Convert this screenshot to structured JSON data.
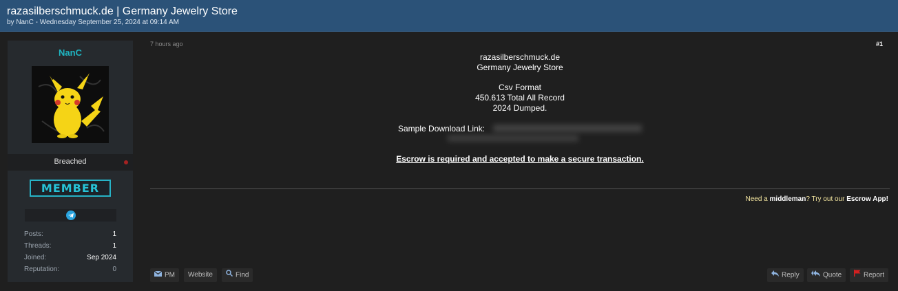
{
  "thread": {
    "title": "razasilberschmuck.de | Germany Jewelry Store",
    "byline": "by NanC - Wednesday September 25, 2024 at 09:14 AM"
  },
  "author": {
    "username": "NanC",
    "status": "Breached",
    "rank": "MEMBER",
    "contact_icon": "telegram-icon",
    "stats": [
      {
        "label": "Posts:",
        "value": "1"
      },
      {
        "label": "Threads:",
        "value": "1"
      },
      {
        "label": "Joined:",
        "value": "Sep 2024"
      },
      {
        "label": "Reputation:",
        "value": "0"
      }
    ]
  },
  "post": {
    "time": "7 hours ago",
    "number": "#1",
    "lines": [
      "razasilberschmuck.de",
      "Germany Jewelry Store",
      "Csv Format",
      "450.613 Total All Record",
      "2024 Dumped."
    ],
    "sample_label": "Sample Download Link:",
    "escrow_text": " Escrow is required and accepted to make a secure transaction.",
    "signature": {
      "pre": "Need a ",
      "middleman": "middleman",
      "mid": "? Try out our ",
      "escrow_app": "Escrow App!"
    }
  },
  "actions": {
    "pm": "PM",
    "website": "Website",
    "find": "Find",
    "reply": "Reply",
    "quote": "Quote",
    "report": "Report"
  },
  "colors": {
    "header_bg": "#2b5278",
    "username": "#1fb5c2",
    "rank": "#27b3c7",
    "report_icon": "#d22020"
  }
}
